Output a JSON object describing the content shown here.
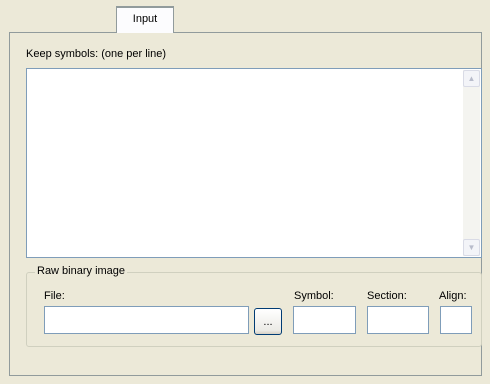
{
  "tabs": [
    {
      "label": "Input"
    }
  ],
  "keep_symbols": {
    "label": "Keep symbols: (one per line)",
    "value": ""
  },
  "raw_binary_image": {
    "legend": "Raw binary image",
    "file_label": "File:",
    "file_value": "",
    "browse_label": "...",
    "symbol_label": "Symbol:",
    "symbol_value": "",
    "section_label": "Section:",
    "section_value": "",
    "align_label": "Align:",
    "align_value": ""
  },
  "scrollbar": {
    "up_icon": "scroll-up-arrow",
    "down_icon": "scroll-down-arrow"
  },
  "colors": {
    "background": "#ece9d8",
    "field_border": "#7f9db9",
    "panel_border": "#919b9c"
  }
}
